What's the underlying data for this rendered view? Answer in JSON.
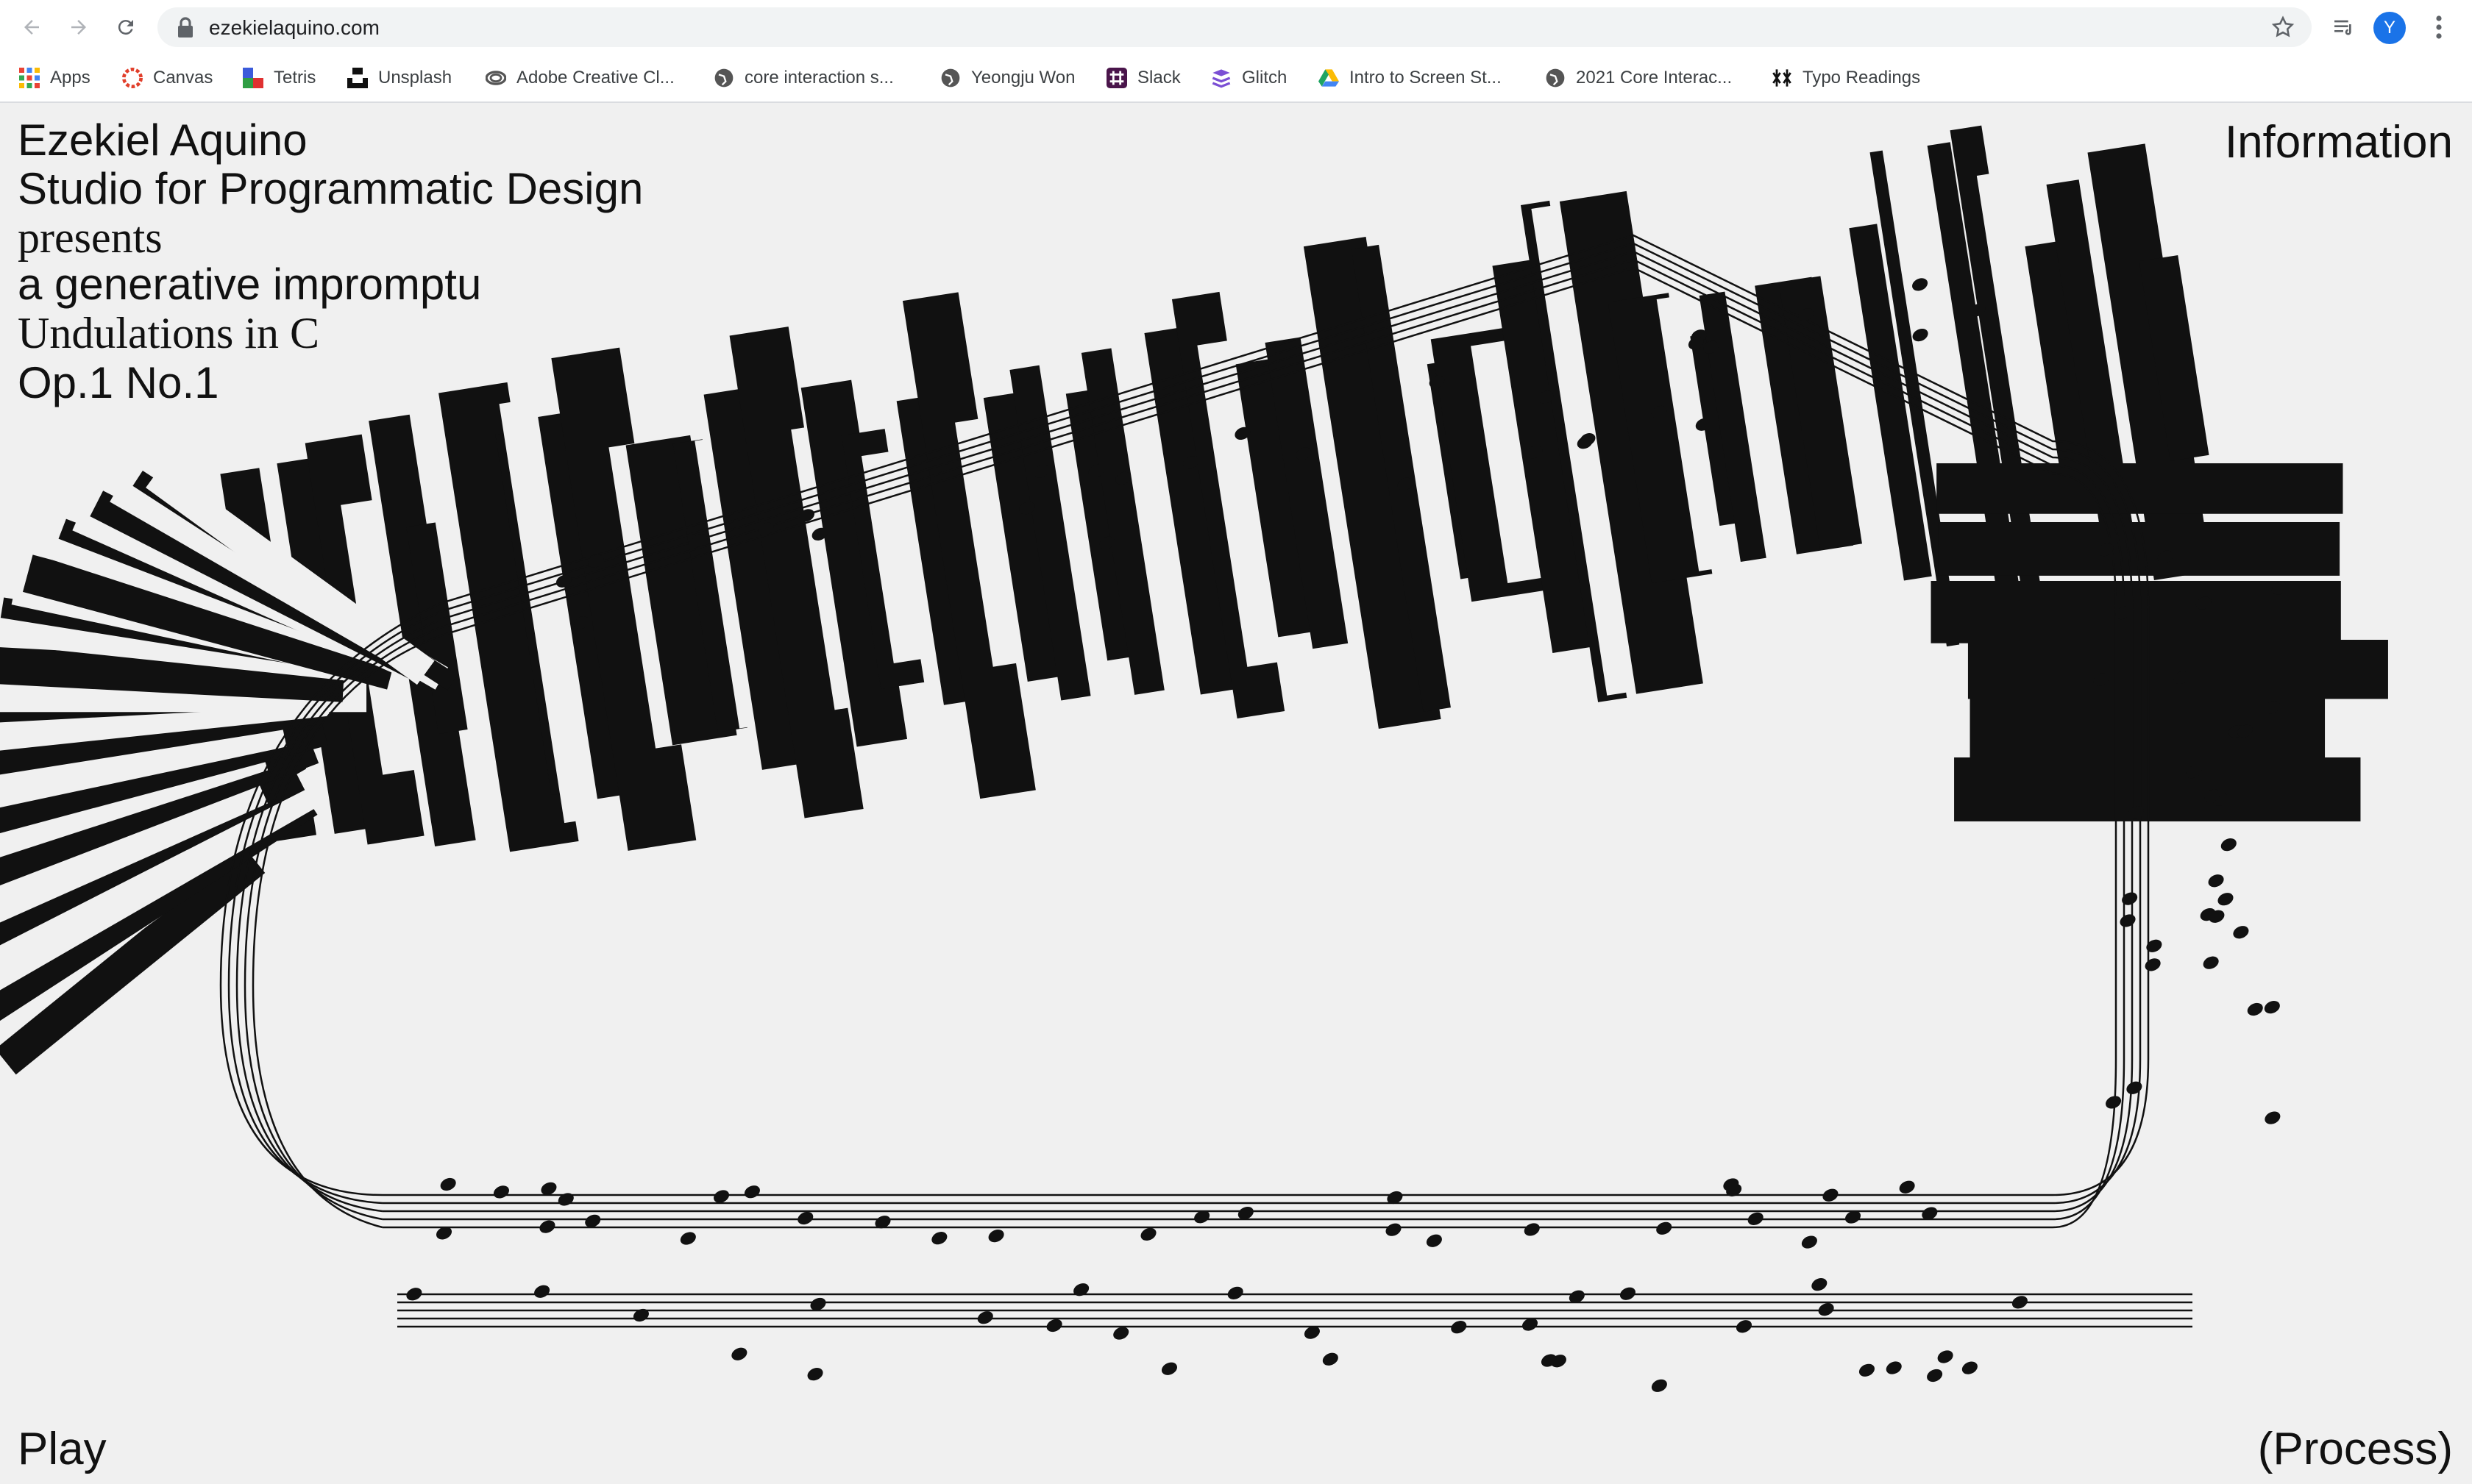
{
  "browser": {
    "url": "ezekielaquino.com",
    "avatar_letter": "Y",
    "bookmarks": [
      {
        "label": "Apps",
        "icon": "apps-grid-icon",
        "color": "#ea4335"
      },
      {
        "label": "Canvas",
        "icon": "canvas-icon",
        "color": "#e13f2b"
      },
      {
        "label": "Tetris",
        "icon": "tetris-icon",
        "color": "#3b5bdb"
      },
      {
        "label": "Unsplash",
        "icon": "unsplash-icon",
        "color": "#111111"
      },
      {
        "label": "Adobe Creative Cl...",
        "icon": "adobe-cc-icon",
        "color": "#555555"
      },
      {
        "label": "core interaction s...",
        "icon": "globe-icon",
        "color": "#555555"
      },
      {
        "label": "Yeongju Won",
        "icon": "globe-icon",
        "color": "#555555"
      },
      {
        "label": "Slack",
        "icon": "slack-icon",
        "color": "#4a154b"
      },
      {
        "label": "Glitch",
        "icon": "glitch-icon",
        "color": "#7b4fd4"
      },
      {
        "label": "Intro to Screen St...",
        "icon": "google-drive-icon",
        "color": "#1fa463"
      },
      {
        "label": "2021 Core Interac...",
        "icon": "globe-icon",
        "color": "#555555"
      },
      {
        "label": "Typo Readings",
        "icon": "asterisk-icon",
        "color": "#111111"
      }
    ]
  },
  "site": {
    "title_lines": [
      "Ezekiel Aquino",
      "Studio for Programmatic Design",
      "presents",
      "a generative impromptu",
      "Undulations in C",
      "Op.1 No.1"
    ],
    "nav_information": "Information",
    "nav_play": "Play",
    "nav_process": "(Process)"
  }
}
